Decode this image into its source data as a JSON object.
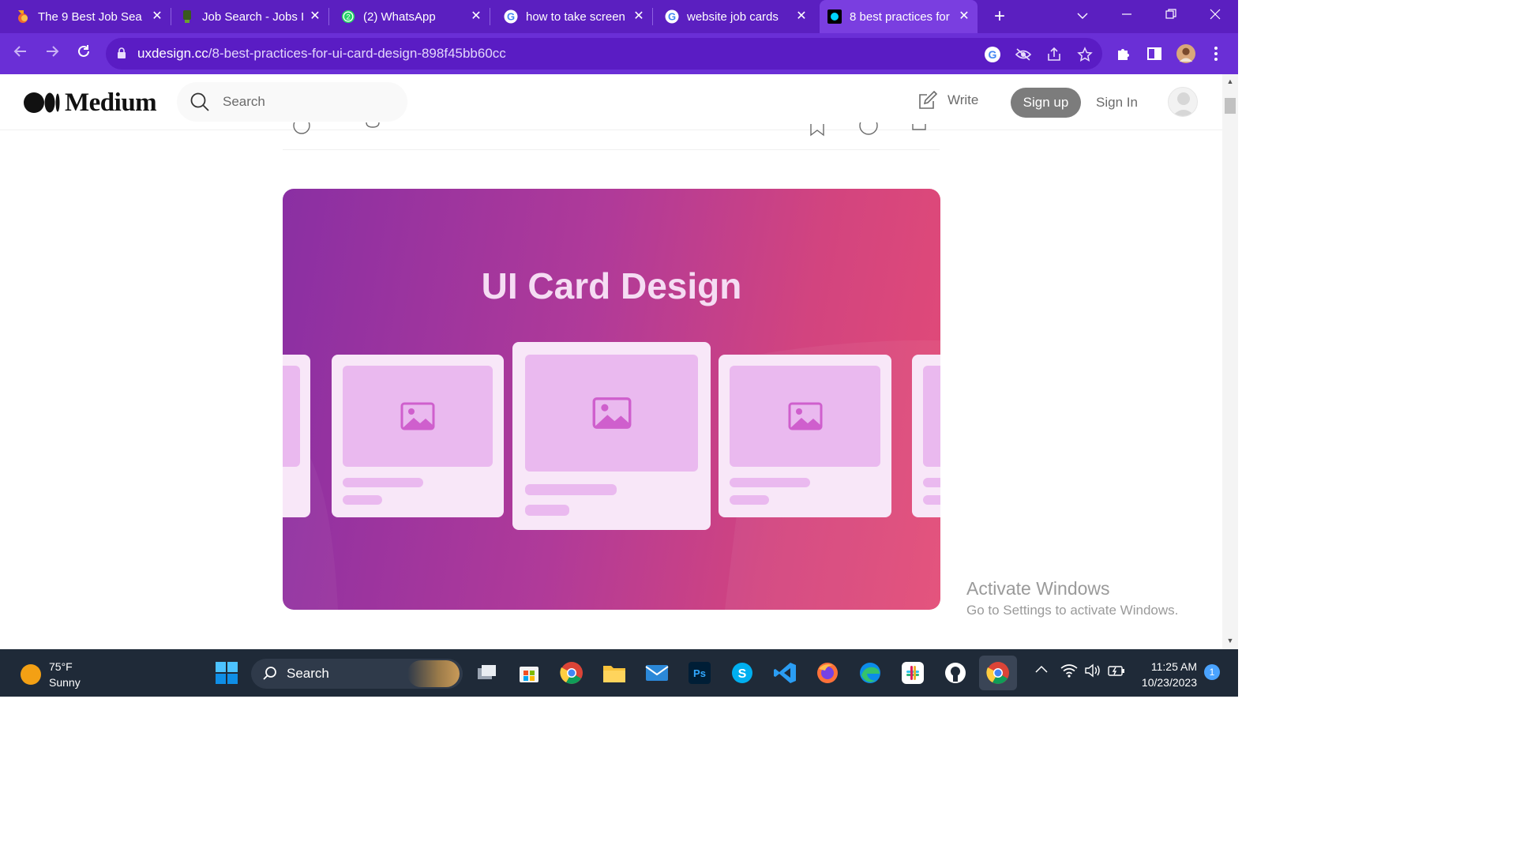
{
  "browser": {
    "tabs": [
      {
        "title": "The 9 Best Job Sea",
        "active": false
      },
      {
        "title": "Job Search - Jobs I",
        "active": false
      },
      {
        "title": "(2) WhatsApp",
        "active": false
      },
      {
        "title": "how to take screen",
        "active": false
      },
      {
        "title": "website job cards",
        "active": false
      },
      {
        "title": "8 best practices for",
        "active": true
      }
    ],
    "new_tab_label": "+",
    "whatsapp_badge": "2",
    "url_host": "uxdesign.cc",
    "url_path": "/8-best-practices-for-ui-card-design-898f45bb60cc",
    "colors": {
      "tabstrip": "#5b1fc0",
      "toolbar": "#6a2fd6",
      "omnibox": "#5a1cc4"
    }
  },
  "medium": {
    "logo_text": "Medium",
    "search_placeholder": "Search",
    "write_label": "Write",
    "signup_label": "Sign up",
    "signin_label": "Sign In"
  },
  "article": {
    "hero_title": "UI Card Design",
    "hero_colors": {
      "start": "#8a2fa3",
      "end": "#e34b77",
      "card": "#f8e7f8",
      "placeholder": "#eab9ef"
    }
  },
  "watermark": {
    "line1": "Activate Windows",
    "line2": "Go to Settings to activate Windows."
  },
  "taskbar": {
    "weather_temp": "75°F",
    "weather_desc": "Sunny",
    "search_label": "Search",
    "time": "11:25 AM",
    "date": "10/23/2023",
    "notification_count": "1",
    "apps": [
      "start-icon",
      "task-view-icon",
      "store-icon",
      "chrome-icon",
      "file-explorer-icon",
      "mail-icon",
      "photoshop-icon",
      "skype-icon",
      "vscode-icon",
      "firefox-icon",
      "edge-icon",
      "slack-icon",
      "github-icon",
      "chrome-active-icon"
    ]
  }
}
